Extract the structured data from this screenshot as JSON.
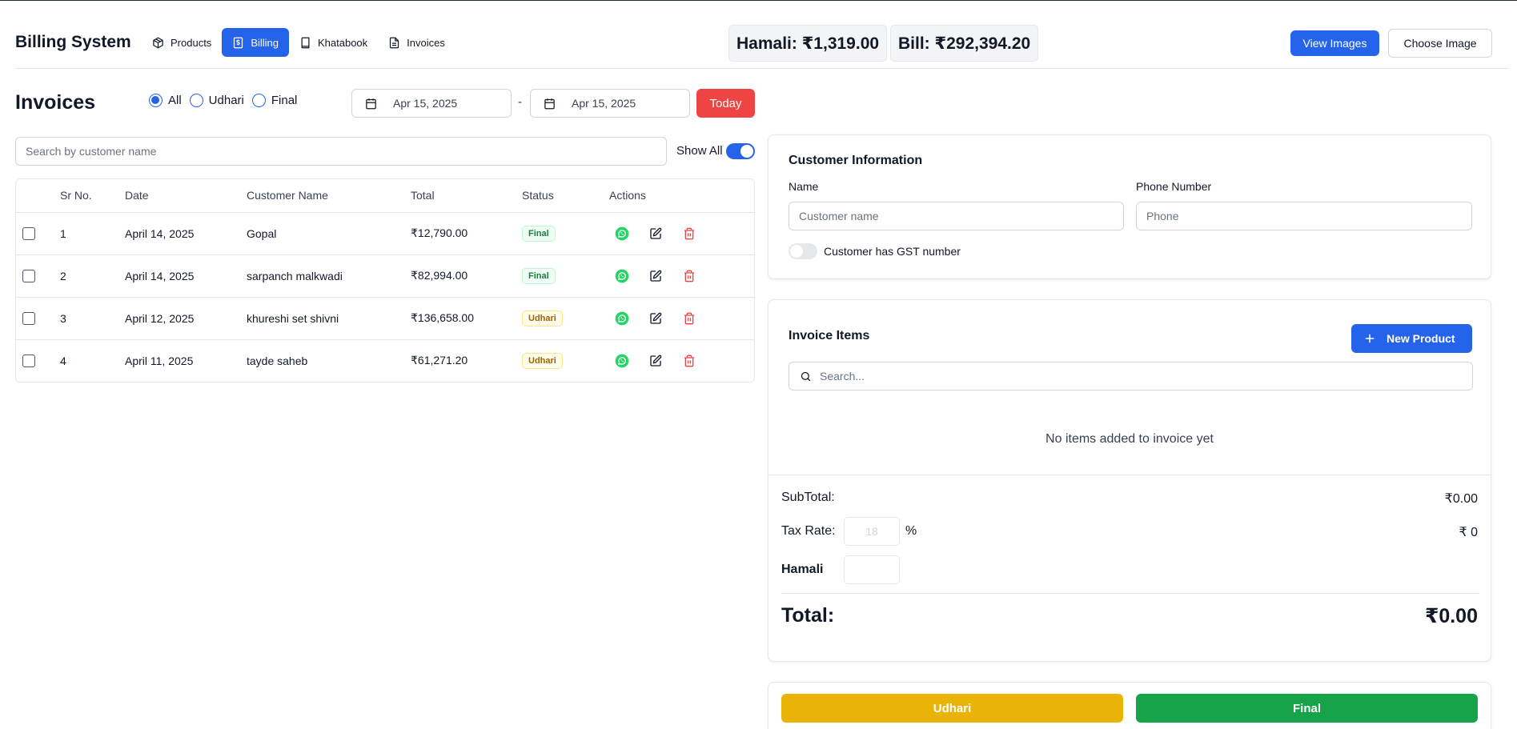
{
  "app": {
    "title": "Billing System"
  },
  "nav": {
    "products": "Products",
    "billing": "Billing",
    "khatabook": "Khatabook",
    "invoices": "Invoices"
  },
  "stats": {
    "hamali": "Hamali: ₹1,319.00",
    "bill": "Bill: ₹292,394.20"
  },
  "header_buttons": {
    "view_images": "View Images",
    "choose_image": "Choose Image"
  },
  "invoices": {
    "title": "Invoices",
    "filters": [
      {
        "label": "All",
        "checked": true
      },
      {
        "label": "Udhari",
        "checked": false
      },
      {
        "label": "Final",
        "checked": false
      }
    ],
    "date_from": "Apr 15, 2025",
    "date_separator": "-",
    "date_to": "Apr 15, 2025",
    "today_label": "Today",
    "search_placeholder": "Search by customer name",
    "show_all_label": "Show All",
    "show_all_on": true,
    "columns": {
      "sr": "Sr No.",
      "date": "Date",
      "customer": "Customer Name",
      "total": "Total",
      "status": "Status",
      "actions": "Actions"
    },
    "rows": [
      {
        "sr": "1",
        "date": "April 14, 2025",
        "customer": "Gopal",
        "total": "₹12,790.00",
        "status": "Final"
      },
      {
        "sr": "2",
        "date": "April 14, 2025",
        "customer": "sarpanch malkwadi",
        "total": "₹82,994.00",
        "status": "Final"
      },
      {
        "sr": "3",
        "date": "April 12, 2025",
        "customer": "khureshi set shivni",
        "total": "₹136,658.00",
        "status": "Udhari"
      },
      {
        "sr": "4",
        "date": "April 11, 2025",
        "customer": "tayde saheb",
        "total": "₹61,271.20",
        "status": "Udhari"
      }
    ]
  },
  "customer": {
    "title": "Customer Information",
    "name_label": "Name",
    "name_placeholder": "Customer name",
    "phone_label": "Phone Number",
    "phone_placeholder": "Phone",
    "gst_label": "Customer has GST number",
    "gst_on": false
  },
  "items": {
    "title": "Invoice Items",
    "new_product_label": "New Product",
    "search_placeholder": "Search...",
    "empty_message": "No items added to invoice yet"
  },
  "summary": {
    "subtotal_label": "SubTotal:",
    "subtotal_value": "₹0.00",
    "tax_label": "Tax Rate:",
    "tax_placeholder": "18",
    "tax_unit": "%",
    "tax_value": "₹ 0",
    "hamali_label": "Hamali",
    "hamali_value": "",
    "total_label": "Total:",
    "total_value": "₹0.00"
  },
  "footer_buttons": {
    "udhari": "Udhari",
    "final": "Final"
  },
  "icons": {
    "products": "package-icon",
    "billing": "receipt-icon",
    "khatabook": "book-icon",
    "invoices": "file-text-icon",
    "calendar": "calendar-icon",
    "whatsapp": "whatsapp-icon",
    "edit": "edit-icon",
    "delete": "trash-icon",
    "plus": "plus-icon",
    "search": "search-icon"
  },
  "colors": {
    "primary": "#2563eb",
    "danger": "#ef4444",
    "success": "#16a34a",
    "warning": "#eab308",
    "whatsapp": "#25d366"
  }
}
